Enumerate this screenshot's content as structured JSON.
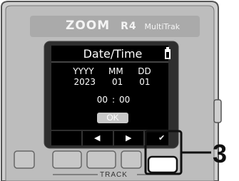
{
  "device": {
    "brand": "ZOOM",
    "model": "R4",
    "subtitle": "MultiTrak",
    "bottom_label": "TRACK"
  },
  "screen": {
    "title": "Date/Time",
    "battery_icon": "battery-icon",
    "date_headers": [
      "YYYY",
      "MM",
      "DD"
    ],
    "date_values": [
      "2023",
      "01",
      "01"
    ],
    "time": {
      "hour": "00",
      "separator": ":",
      "minute": "00"
    },
    "ok_label": "OK"
  },
  "softkeys": [
    {
      "icon": "left-arrow-icon",
      "glyph": "◀"
    },
    {
      "icon": "right-arrow-icon",
      "glyph": "▶"
    },
    {
      "icon": "check-icon",
      "glyph": "✔"
    }
  ],
  "callout": {
    "number": "3"
  }
}
